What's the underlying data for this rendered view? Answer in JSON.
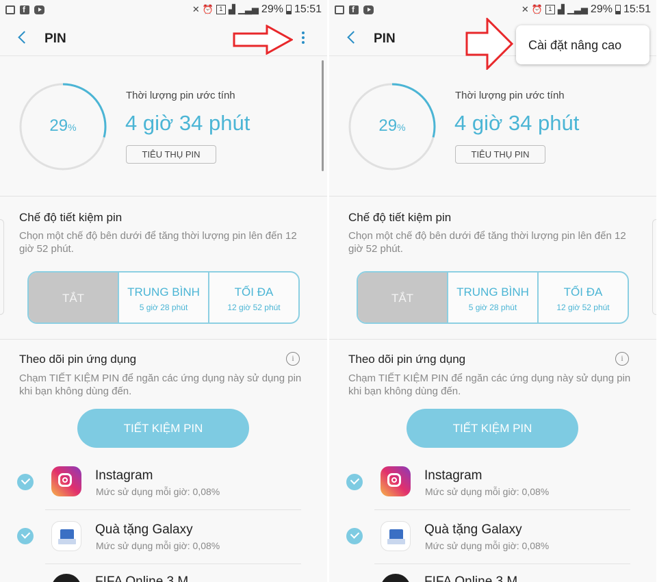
{
  "status_bar": {
    "battery": "29%",
    "time": "15:51"
  },
  "header": {
    "title": "PIN"
  },
  "battery": {
    "percent": "29",
    "percent_unit": "%",
    "level": 0.29,
    "estimate_label": "Thời lượng pin ước tính",
    "estimate_value": "4 giờ 34 phút",
    "usage_button": "TIÊU THỤ PIN"
  },
  "power_saving": {
    "title": "Chế độ tiết kiệm pin",
    "description": "Chọn một chế độ bên dưới để tăng thời lượng pin lên đến 12 giờ 52 phút.",
    "modes": [
      {
        "label": "TẮT",
        "sub": ""
      },
      {
        "label": "TRUNG BÌNH",
        "sub": "5 giờ 28 phút"
      },
      {
        "label": "TỐI ĐA",
        "sub": "12 giờ 52 phút"
      }
    ],
    "selected": "TẮT"
  },
  "app_monitor": {
    "title": "Theo dõi pin ứng dụng",
    "info_icon": "i",
    "description": "Chạm TIẾT KIỆM PIN để ngăn các ứng dụng này sử dụng pin khi bạn không dùng đến.",
    "save_button": "TIẾT KIỆM PIN",
    "apps": [
      {
        "name": "Instagram",
        "usage": "Mức sử dụng mỗi giờ: 0,08%",
        "icon": "instagram-icon",
        "checked": true
      },
      {
        "name": "Quà tặng Galaxy",
        "usage": "Mức sử dụng mỗi giờ: 0,08%",
        "icon": "galaxy-gift-icon",
        "checked": true
      },
      {
        "name": "FIFA Online 3 M",
        "usage": "",
        "icon": "fifa-icon",
        "checked": false
      }
    ]
  },
  "popup_menu": {
    "item": "Cài đặt nâng cao"
  },
  "colors": {
    "accent": "#4bb5d5",
    "button_fill": "#7ecbe2",
    "ring_track": "#e0e0e0",
    "annotation_arrow": "#e8282b"
  }
}
